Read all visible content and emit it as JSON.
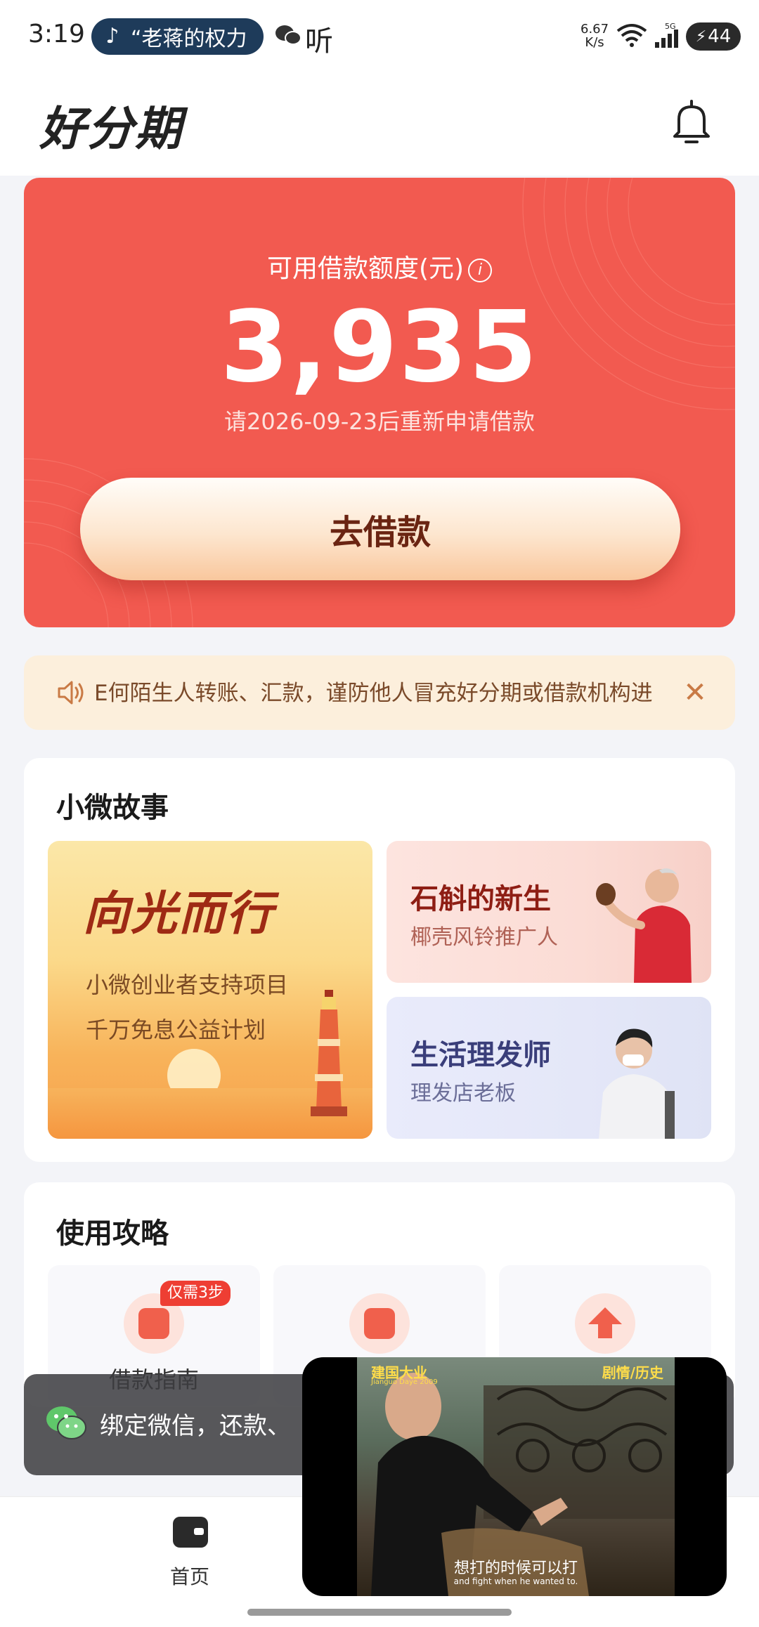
{
  "status_bar": {
    "time": "3:19",
    "notification_text": "“老蒋的权力",
    "app_label": "听",
    "net_speed_value": "6.67",
    "net_speed_unit": "K/s",
    "signal_type": "5G",
    "battery": "44"
  },
  "header": {
    "logo": "好分期",
    "bell_icon": "bell-icon"
  },
  "credit": {
    "label": "可用借款额度(元)",
    "info_icon": "i",
    "amount": "3,935",
    "note": "请2026-09-23后重新申请借款",
    "button_label": "去借款",
    "colors": {
      "card": "#f25a50",
      "button_text": "#6a2412"
    }
  },
  "notice": {
    "text": "E何陌生人转账、汇款，谨防他人冒充好分期或借款机构进",
    "close": "✕"
  },
  "stories": {
    "title": "小微故事",
    "main": {
      "title": "向光而行",
      "line1": "小微创业者支持项目",
      "line2": "千万免息公益计划"
    },
    "cards": [
      {
        "title": "石斛的新生",
        "subtitle": "椰壳风铃推广人"
      },
      {
        "title": "生活理发师",
        "subtitle": "理发店老板"
      }
    ]
  },
  "guide": {
    "title": "使用攻略",
    "items": [
      {
        "label": "借款指南",
        "badge": "仅需3步"
      },
      {
        "label": ""
      },
      {
        "label": ""
      }
    ]
  },
  "toast": {
    "text": "绑定微信，还款、"
  },
  "bottom_nav": {
    "home_label": "首页"
  },
  "video": {
    "tag_left": "建国大业",
    "tag_left_sub": "Jianguo Daye 2009",
    "tag_right": "剧情/历史",
    "subtitle_cn": "想打的时候可以打",
    "subtitle_en": "and fight when he wanted to."
  }
}
